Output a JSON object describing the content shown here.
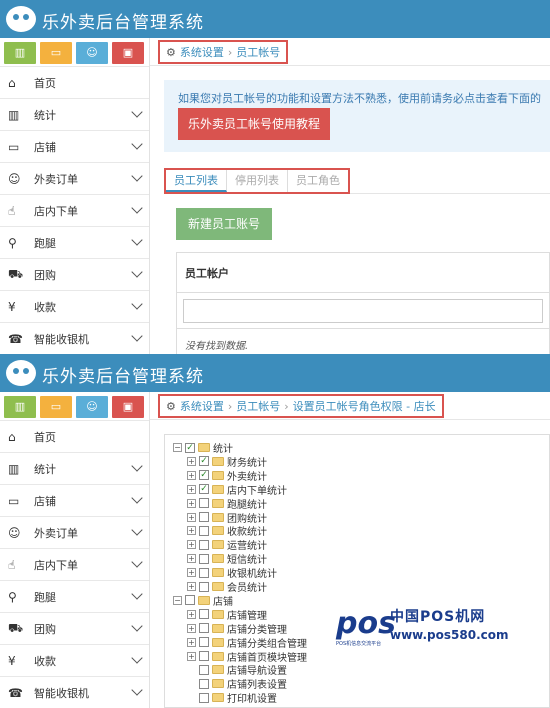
{
  "app_title": "乐外卖后台管理系统",
  "quick_buttons": [
    {
      "icon": "bar-chart-icon",
      "glyph": "▥",
      "color": "#8fbe4e"
    },
    {
      "icon": "monitor-icon",
      "glyph": "▭",
      "color": "#f4b13e"
    },
    {
      "icon": "smiley-icon",
      "glyph": "☺",
      "color": "#5aaed8"
    },
    {
      "icon": "briefcase-icon",
      "glyph": "▣",
      "color": "#d9534f"
    }
  ],
  "menu": [
    {
      "label": "首页",
      "icon": "home-icon",
      "glyph": "⌂",
      "expandable": false
    },
    {
      "label": "统计",
      "icon": "bar-chart-icon",
      "glyph": "▥",
      "expandable": true
    },
    {
      "label": "店铺",
      "icon": "monitor-icon",
      "glyph": "▭",
      "expandable": true
    },
    {
      "label": "外卖订单",
      "icon": "smiley-icon",
      "glyph": "☺",
      "expandable": true
    },
    {
      "label": "店内下单",
      "icon": "hand-pointer-icon",
      "glyph": "☝",
      "expandable": true
    },
    {
      "label": "跑腿",
      "icon": "bicycle-icon",
      "glyph": "⚲",
      "expandable": true
    },
    {
      "label": "团购",
      "icon": "cart-icon",
      "glyph": "⛟",
      "expandable": true
    },
    {
      "label": "收款",
      "icon": "yen-icon",
      "glyph": "¥",
      "expandable": true
    },
    {
      "label": "智能收银机",
      "icon": "cash-register-icon",
      "glyph": "☎",
      "expandable": true
    }
  ],
  "screen1": {
    "breadcrumb": [
      "系统设置",
      "员工帐号"
    ],
    "notice_text": "如果您对员工帐号的功能和设置方法不熟悉，使用前请务必点击查看下面的",
    "help_button": "乐外卖员工帐号使用教程",
    "tabs": [
      {
        "label": "员工列表",
        "active": true
      },
      {
        "label": "停用列表",
        "active": false
      },
      {
        "label": "员工角色",
        "active": false
      }
    ],
    "new_button": "新建员工账号",
    "table_header": "员工帐户",
    "empty_text": "没有找到数据."
  },
  "screen2": {
    "breadcrumb": [
      "系统设置",
      "员工帐号",
      "设置员工帐号角色权限 - 店长"
    ],
    "tree": [
      {
        "label": "统计",
        "depth": 0,
        "expander": "−",
        "checked": true
      },
      {
        "label": "财务统计",
        "depth": 1,
        "expander": "+",
        "checked": true
      },
      {
        "label": "外卖统计",
        "depth": 1,
        "expander": "+",
        "checked": true
      },
      {
        "label": "店内下单统计",
        "depth": 1,
        "expander": "+",
        "checked": true
      },
      {
        "label": "跑腿统计",
        "depth": 1,
        "expander": "+",
        "checked": false
      },
      {
        "label": "团购统计",
        "depth": 1,
        "expander": "+",
        "checked": false
      },
      {
        "label": "收款统计",
        "depth": 1,
        "expander": "+",
        "checked": false
      },
      {
        "label": "运营统计",
        "depth": 1,
        "expander": "+",
        "checked": false
      },
      {
        "label": "短信统计",
        "depth": 1,
        "expander": "+",
        "checked": false
      },
      {
        "label": "收银机统计",
        "depth": 1,
        "expander": "+",
        "checked": false
      },
      {
        "label": "会员统计",
        "depth": 1,
        "expander": "+",
        "checked": false
      },
      {
        "label": "店铺",
        "depth": 0,
        "expander": "−",
        "checked": false
      },
      {
        "label": "店铺管理",
        "depth": 1,
        "expander": "+",
        "checked": false
      },
      {
        "label": "店铺分类管理",
        "depth": 1,
        "expander": "+",
        "checked": false
      },
      {
        "label": "店铺分类组合管理",
        "depth": 1,
        "expander": "+",
        "checked": false
      },
      {
        "label": "店铺首页模块管理",
        "depth": 1,
        "expander": "+",
        "checked": false
      },
      {
        "label": "店铺导航设置",
        "depth": 1,
        "expander": "",
        "checked": false
      },
      {
        "label": "店铺列表设置",
        "depth": 1,
        "expander": "",
        "checked": false
      },
      {
        "label": "打印机设置",
        "depth": 1,
        "expander": "",
        "checked": false
      }
    ],
    "watermark": {
      "logo": "pos",
      "tagline": "POS机信息交流平台",
      "site_name": "中国POS机网",
      "url": "www.pos580.com"
    }
  }
}
